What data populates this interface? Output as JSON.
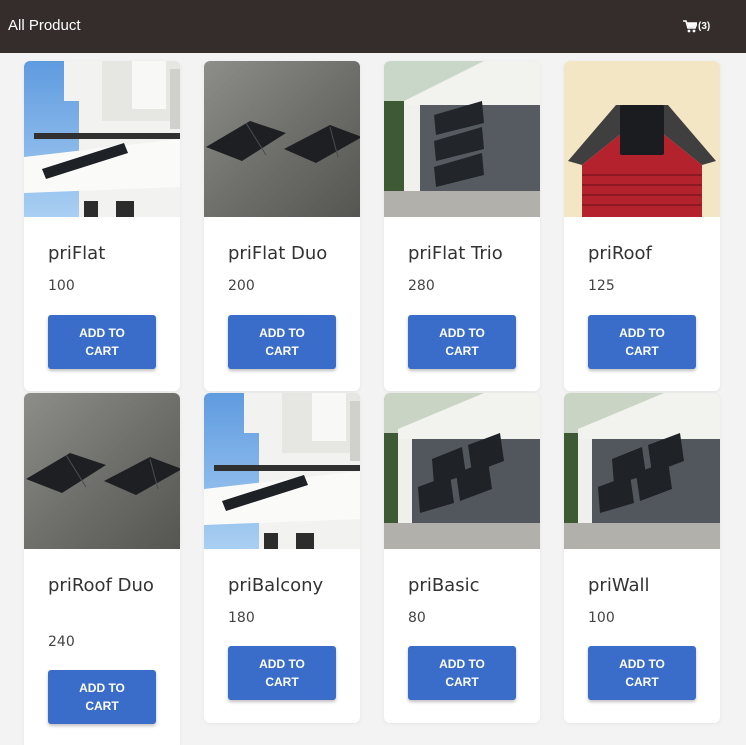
{
  "header": {
    "title": "All Product",
    "cart_icon": "cart-icon",
    "cart_count": "(3)"
  },
  "colors": {
    "header_bg": "#342d2b",
    "button_bg": "#3a6cc9",
    "page_bg": "#f3f3f3"
  },
  "products": [
    {
      "name": "priFlat",
      "price": "100",
      "button": "ADD TO CART",
      "image": "balcony-house"
    },
    {
      "name": "priFlat Duo",
      "price": "200",
      "button": "ADD TO CART",
      "image": "flat-panels-concrete"
    },
    {
      "name": "priFlat Trio",
      "price": "280",
      "button": "ADD TO CART",
      "image": "wall-house-three-panels"
    },
    {
      "name": "priRoof",
      "price": "125",
      "button": "ADD TO CART",
      "image": "roof-house"
    },
    {
      "name": "priRoof Duo",
      "price": "240",
      "button": "ADD TO CART",
      "image": "flat-panels-concrete"
    },
    {
      "name": "priBalcony",
      "price": "180",
      "button": "ADD TO CART",
      "image": "balcony-house"
    },
    {
      "name": "priBasic",
      "price": "80",
      "button": "ADD TO CART",
      "image": "wall-house-four-panels"
    },
    {
      "name": "priWall",
      "price": "100",
      "button": "ADD TO CART",
      "image": "wall-house-four-panels"
    }
  ]
}
